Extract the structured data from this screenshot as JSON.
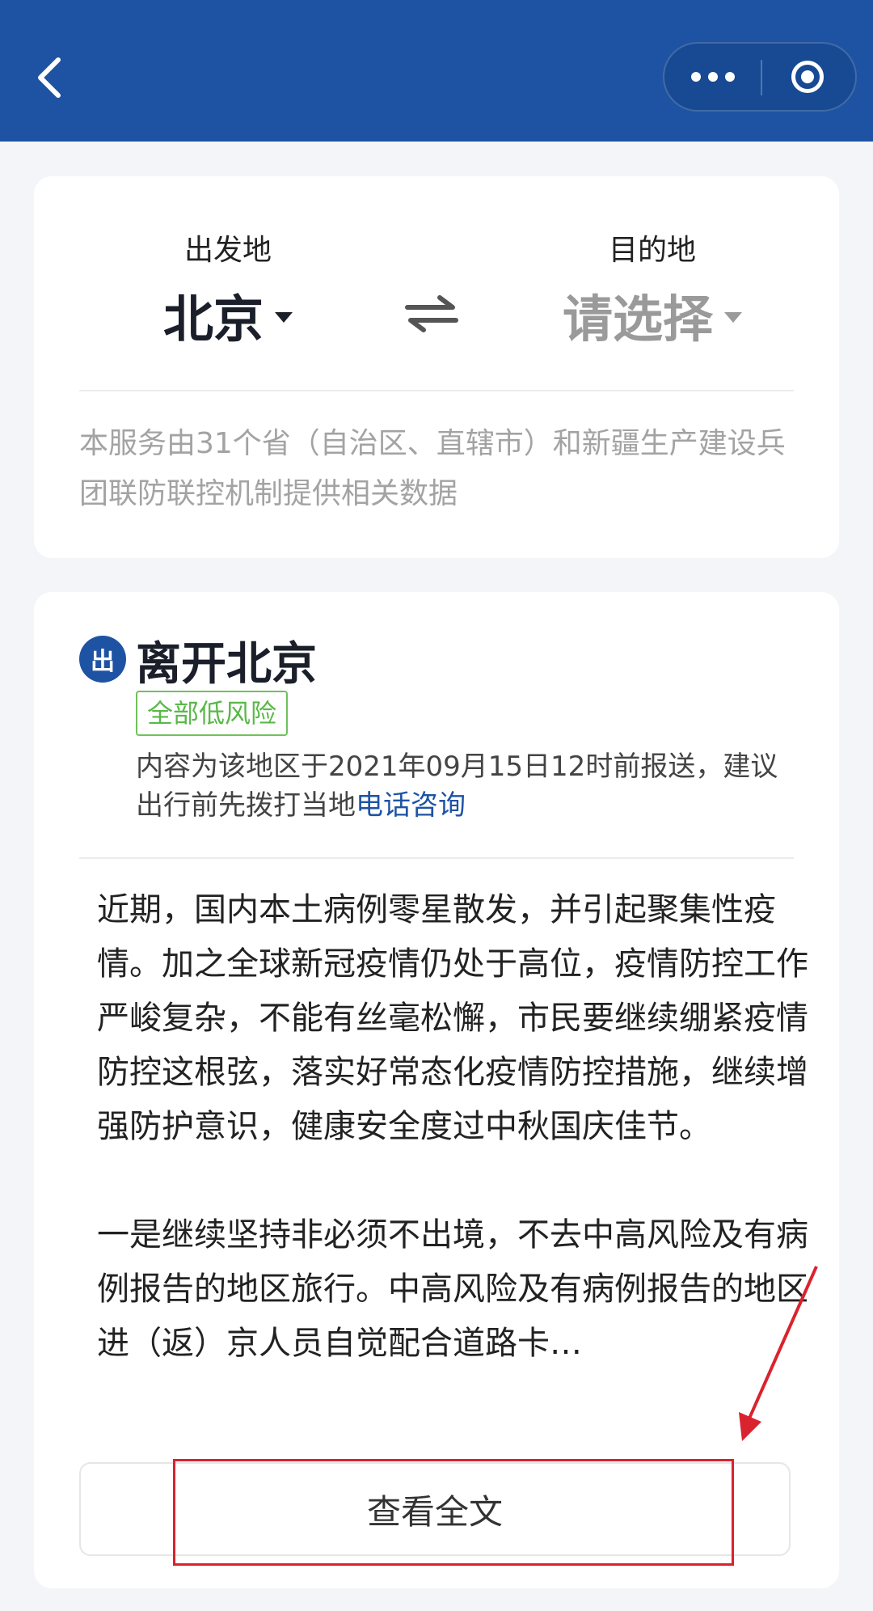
{
  "header": {
    "back_icon": "chevron-left-icon",
    "more_icon": "more-dots-icon",
    "close_icon": "target-ring-icon",
    "colors": {
      "bar": "#1e53a3"
    }
  },
  "route": {
    "from_label": "出发地",
    "from_value": "北京",
    "to_label": "目的地",
    "to_value": "请选择",
    "swap_icon": "swap-arrows-icon",
    "notice": "本服务由31个省（自治区、直辖市）和新疆生产建设兵团联防联控机制提供相关数据"
  },
  "leave": {
    "badge": "出",
    "title": "离开北京",
    "risk_tag": "全部低风险",
    "report_prefix": "内容为该地区于2021年09月15日12时前报送，建议出行前先拨打当地",
    "report_link": "电话咨询",
    "paragraph1": "近期，国内本土病例零星散发，并引起聚集性疫情。加之全球新冠疫情仍处于高位，疫情防控工作严峻复杂，不能有丝毫松懈，市民要继续绷紧疫情防控这根弦，落实好常态化疫情防控措施，继续增强防护意识，健康安全度过中秋国庆佳节。",
    "paragraph2": "一是继续坚持非必须不出境，不去中高风险及有病例报告的地区旅行。中高风险及有病例报告的地区进（返）京人员自觉配合道路卡…",
    "view_full": "查看全文"
  },
  "annotation": {
    "color": "#d9232e"
  }
}
